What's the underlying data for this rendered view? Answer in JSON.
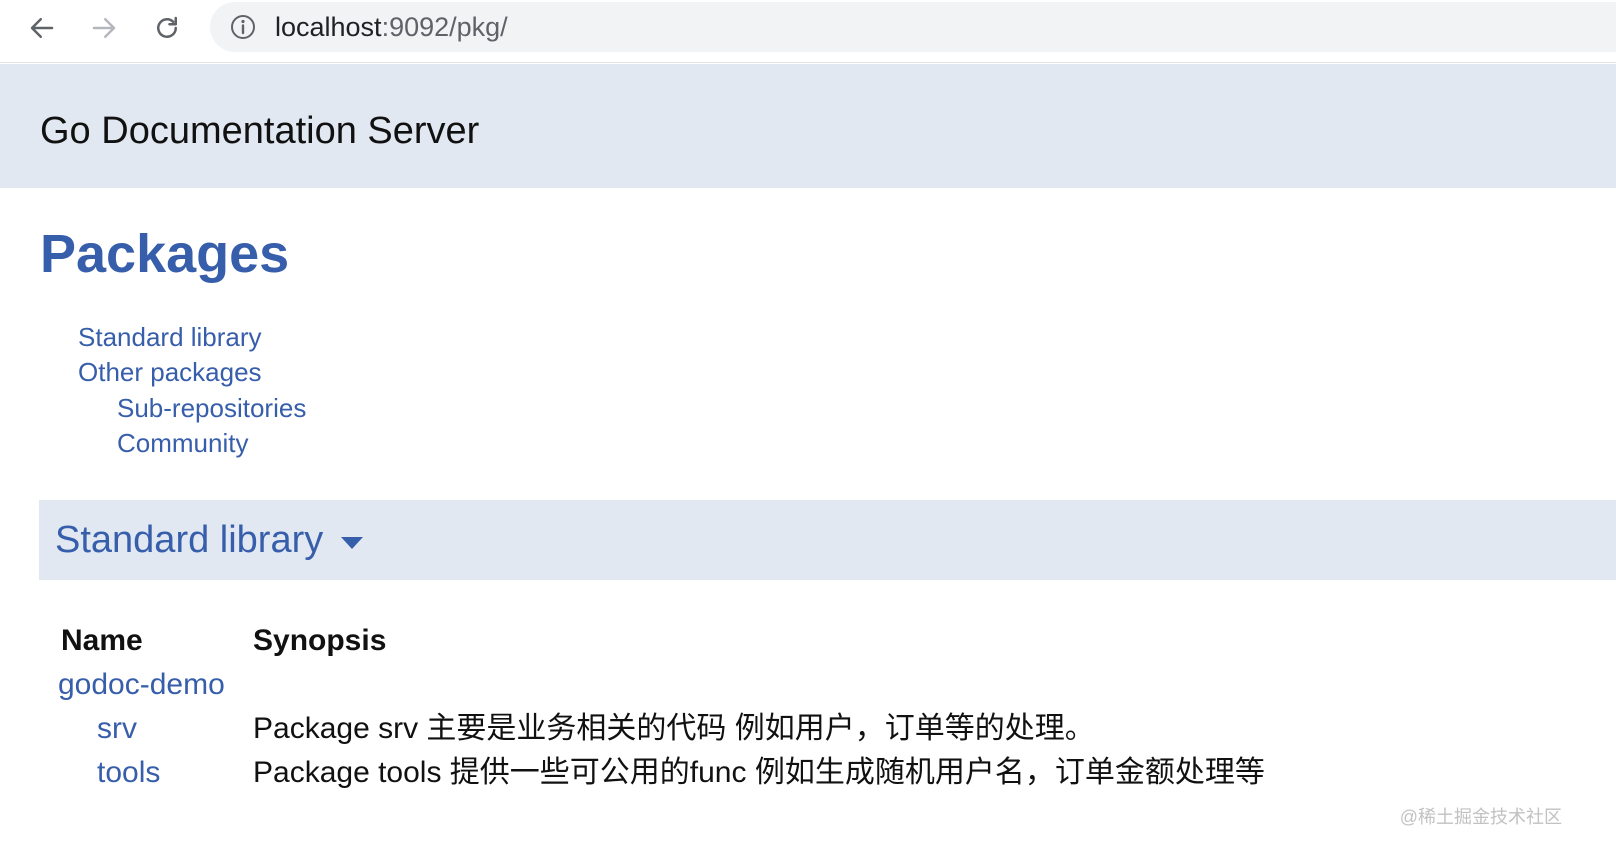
{
  "browser": {
    "url_host": "localhost",
    "url_rest": ":9092/pkg/",
    "icons": {
      "back": "arrow-left-icon",
      "forward": "arrow-right-icon",
      "reload": "reload-icon",
      "info": "info-icon"
    }
  },
  "header": {
    "title": "Go Documentation Server"
  },
  "page": {
    "title": "Packages",
    "toc": {
      "standard": "Standard library",
      "other": "Other packages",
      "sub": "Sub-repositories",
      "community": "Community"
    },
    "section": {
      "title": "Standard library",
      "caret_icon": "caret-down-icon"
    },
    "table": {
      "headers": {
        "name": "Name",
        "synopsis": "Synopsis"
      },
      "rows": [
        {
          "name": "godoc-demo",
          "synopsis": ""
        },
        {
          "name": "srv",
          "synopsis": "Package srv 主要是业务相关的代码 例如用户，订单等的处理。"
        },
        {
          "name": "tools",
          "synopsis": "Package tools 提供一些可公用的func 例如生成随机用户名，订单金额处理等"
        }
      ]
    }
  },
  "watermark": "@稀土掘金技术社区",
  "colors": {
    "link": "#375eab",
    "band": "#e1e8f2",
    "omnibox": "#f1f3f4"
  }
}
